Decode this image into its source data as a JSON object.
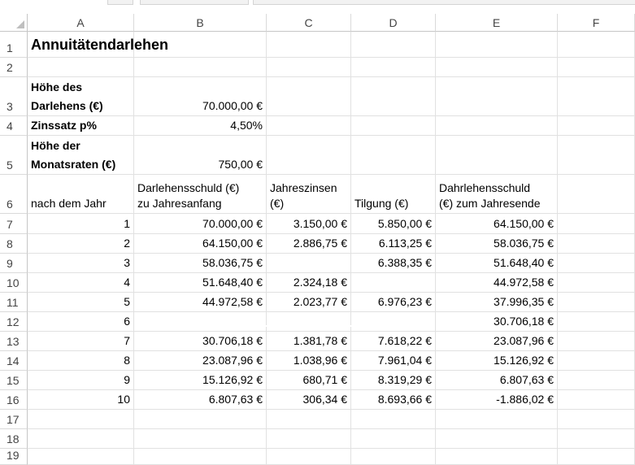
{
  "columns": [
    "A",
    "B",
    "C",
    "D",
    "E",
    "F"
  ],
  "rows": [
    "1",
    "2",
    "3",
    "4",
    "5",
    "6",
    "7",
    "8",
    "9",
    "10",
    "11",
    "12",
    "13",
    "14",
    "15",
    "16",
    "17",
    "18",
    "19"
  ],
  "sheet": {
    "title": "Annuitätendarlehen",
    "labels": {
      "loan_amount_line1": "Höhe des",
      "loan_amount_line2": "Darlehens (€)",
      "interest_rate": "Zinssatz p%",
      "monthly_rate_line1": "Höhe der",
      "monthly_rate_line2": "Monatsraten (€)"
    },
    "values": {
      "loan_amount": "70.000,00 €",
      "interest_rate": "4,50%",
      "monthly_rate": "750,00 €"
    },
    "headers": {
      "year": "nach dem Jahr",
      "debt_start_line1": "Darlehensschuld (€)",
      "debt_start_line2": "zu Jahresanfang",
      "interest_line1": "Jahreszinsen",
      "interest_line2": "(€)",
      "repayment": "Tilgung (€)",
      "debt_end_line1": "Dahrlehensschuld",
      "debt_end_line2": "(€) zum Jahresende"
    },
    "table": [
      [
        "1",
        "70.000,00 €",
        "3.150,00 €",
        "5.850,00 €",
        "64.150,00 €"
      ],
      [
        "2",
        "64.150,00 €",
        "2.886,75 €",
        "6.113,25 €",
        "58.036,75 €"
      ],
      [
        "3",
        "58.036,75 €",
        "",
        "6.388,35 €",
        "51.648,40 €"
      ],
      [
        "4",
        "51.648,40 €",
        "2.324,18 €",
        "",
        "44.972,58 €"
      ],
      [
        "5",
        "44.972,58 €",
        "2.023,77 €",
        "6.976,23 €",
        "37.996,35 €"
      ],
      [
        "6",
        "",
        "",
        "",
        "30.706,18 €"
      ],
      [
        "7",
        "30.706,18 €",
        "1.381,78 €",
        "7.618,22 €",
        "23.087,96 €"
      ],
      [
        "8",
        "23.087,96 €",
        "1.038,96 €",
        "7.961,04 €",
        "15.126,92 €"
      ],
      [
        "9",
        "15.126,92 €",
        "680,71 €",
        "8.319,29 €",
        "6.807,63 €"
      ],
      [
        "10",
        "6.807,63 €",
        "306,34 €",
        "8.693,66 €",
        "-1.886,02 €"
      ]
    ]
  }
}
